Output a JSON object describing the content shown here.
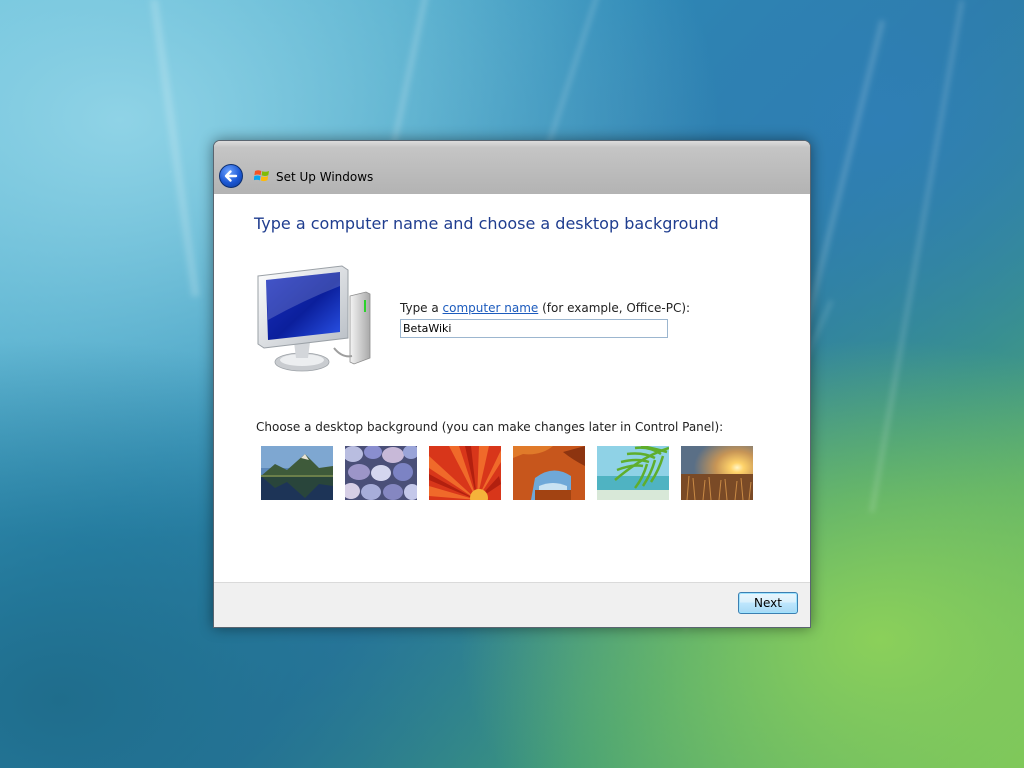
{
  "window": {
    "title": "Set Up Windows"
  },
  "page": {
    "heading": "Type a computer name and choose a desktop background"
  },
  "computer_name": {
    "label_prefix": "Type a ",
    "label_link": "computer name",
    "label_suffix": " (for example, Office-PC):",
    "value": "BetaWiki"
  },
  "background": {
    "label": "Choose a desktop background (you can make changes later in Control Panel):",
    "thumbnails": [
      "mountain-lake",
      "pebbles",
      "red-flower",
      "rock-arch",
      "palm-leaf-beach",
      "sunset-field"
    ]
  },
  "footer": {
    "next_label": "Next"
  },
  "colors": {
    "heading": "#1f3d8f",
    "link": "#1c5bbd",
    "back_button": "#1c58d4"
  },
  "icons": [
    "back-arrow-icon",
    "windows-logo-icon",
    "computer-monitor-icon"
  ]
}
